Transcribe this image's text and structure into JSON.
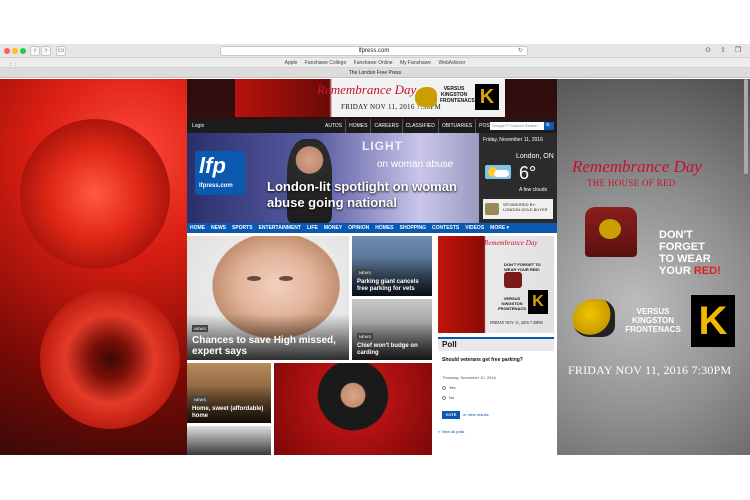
{
  "browser": {
    "url": "lfpress.com",
    "tab_title": "The London Free Press",
    "favorites": [
      "Apple",
      "Fanshawe College",
      "Fanshawe Online",
      "My Fanshawe",
      "WebAdvisor"
    ],
    "back_glyph": "‹",
    "forward_glyph": "›",
    "sidebar_glyph": "▭",
    "reload_glyph": "↻",
    "download_glyph": "⊙",
    "share_glyph": "⇧",
    "tabs_glyph": "❐",
    "grid_glyph": "⋮⋮"
  },
  "banner_top": {
    "title": "Remembrance Day",
    "date": "FRIDAY NOV 11, 2016 7:30PM",
    "versus": "VERSUS KINGSTON FRONTENACS",
    "k_logo": "K"
  },
  "site": {
    "login": "Login",
    "top_links": [
      "AUTOS",
      "HOMES",
      "CAREERS",
      "CLASSIFIED",
      "OBITUARIES",
      "POSTMEDIA"
    ],
    "search_placeholder": "Google™ Custom Search",
    "search_glyph": "🔍",
    "logo_mark": "lfp",
    "logo_sub": "lfpress.com",
    "hero_sign": "LIGHT",
    "hero_sign2": "on woman abuse",
    "hero_headline": "London-lit spotlight on woman abuse going national",
    "nav": [
      "HOME",
      "NEWS",
      "SPORTS",
      "ENTERTAINMENT",
      "LIFE",
      "MONEY",
      "OPINION",
      "HOMES",
      "SHOPPING",
      "CONTESTS",
      "VIDEOS",
      "MORE ▾"
    ]
  },
  "weather": {
    "date": "Friday, November 11, 2016",
    "city": "London, ON",
    "temp": "6°",
    "desc": "A few clouds",
    "sponsor": "SPONSORED BY: LONDON GOLD BUYER"
  },
  "stories": {
    "badge": "NEWS",
    "big": "Chances to save High missed, expert says",
    "parking": "Parking giant cancels free parking for vets",
    "chief": "Chief won't budge on carding",
    "home": "Home, sweet (affordable) home"
  },
  "side_ad": {
    "title": "Remembrance Day",
    "dont": "DON'T FORGET TO WEAR YOUR RED!",
    "versus": "VERSUS KINGSTON FRONTENACS",
    "k_logo": "K",
    "date": "FRIDAY NOV 11, 2016 7:30PM"
  },
  "poll": {
    "title": "Poll",
    "question": "Should veterans get free parking?",
    "date": "Thursday, November 10, 2016",
    "options": [
      "Yes",
      "No"
    ],
    "vote": "VOTE",
    "view_results": "or view results",
    "view_all": "« View all polls"
  },
  "right_ad": {
    "title": "Remembrance Day",
    "subtitle": "THE HOUSE OF RED",
    "dont_line1": "DON'T FORGET",
    "dont_line2": "TO WEAR",
    "dont_line3a": "YOUR ",
    "dont_line3b": "RED!",
    "versus": "VERSUS KINGSTON FRONTENACS",
    "k_logo": "K",
    "date": "FRIDAY NOV 11, 2016 7:30PM"
  },
  "colors": {
    "brand_blue": "#0a58b0",
    "remembrance_red": "#c8102e",
    "topnav": "#1c1c1c"
  }
}
